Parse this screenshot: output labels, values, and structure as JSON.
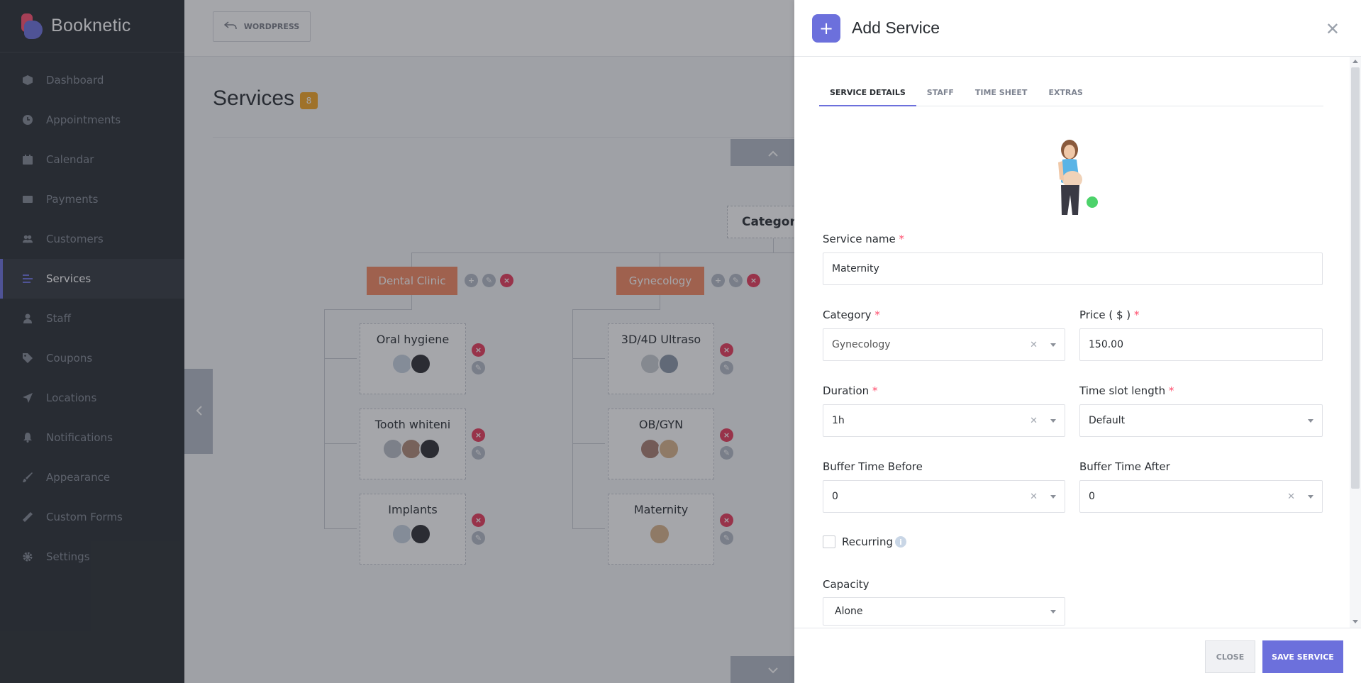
{
  "brand": {
    "name": "Booknetic"
  },
  "sidebar": {
    "items": [
      {
        "label": "Dashboard",
        "icon": "cube-icon"
      },
      {
        "label": "Appointments",
        "icon": "clock-icon"
      },
      {
        "label": "Calendar",
        "icon": "calendar-icon"
      },
      {
        "label": "Payments",
        "icon": "credit-card-icon"
      },
      {
        "label": "Customers",
        "icon": "users-icon"
      },
      {
        "label": "Services",
        "icon": "list-icon",
        "active": true
      },
      {
        "label": "Staff",
        "icon": "user-icon"
      },
      {
        "label": "Coupons",
        "icon": "tag-icon"
      },
      {
        "label": "Locations",
        "icon": "location-arrow-icon"
      },
      {
        "label": "Notifications",
        "icon": "bell-icon"
      },
      {
        "label": "Appearance",
        "icon": "brush-icon"
      },
      {
        "label": "Custom Forms",
        "icon": "magic-wand-icon"
      },
      {
        "label": "Settings",
        "icon": "gear-icon"
      }
    ]
  },
  "topbar": {
    "wordpress_label": "WORDPRESS"
  },
  "services_page": {
    "title": "Services",
    "count": "8",
    "root_category": "Categorie",
    "categories": [
      {
        "name": "Dental Clinic",
        "services": [
          "Oral hygiene",
          "Tooth whiteni",
          "Implants"
        ]
      },
      {
        "name": "Gynecology",
        "services": [
          "3D/4D Ultraso",
          "OB/GYN",
          "Maternity"
        ]
      }
    ]
  },
  "panel": {
    "title": "Add Service",
    "tabs": [
      {
        "label": "SERVICE DETAILS",
        "active": true
      },
      {
        "label": "STAFF"
      },
      {
        "label": "TIME SHEET"
      },
      {
        "label": "EXTRAS"
      }
    ],
    "fields": {
      "service_name": {
        "label": "Service name",
        "value": "Maternity"
      },
      "category": {
        "label": "Category",
        "value": "Gynecology"
      },
      "price": {
        "label": "Price ( $ )",
        "value": "150.00"
      },
      "duration": {
        "label": "Duration",
        "value": "1h"
      },
      "time_slot": {
        "label": "Time slot length",
        "value": "Default"
      },
      "buffer_before": {
        "label": "Buffer Time Before",
        "value": "0"
      },
      "buffer_after": {
        "label": "Buffer Time After",
        "value": "0"
      },
      "recurring": {
        "label": "Recurring",
        "checked": false
      },
      "capacity": {
        "label": "Capacity",
        "value": "Alone"
      }
    },
    "required_mark": "*",
    "buttons": {
      "close": "CLOSE",
      "save": "SAVE SERVICE"
    }
  },
  "colors": {
    "accent": "#6c70dc",
    "category": "#f58861",
    "danger": "#e83a5a",
    "sidebar": "#292d32"
  }
}
